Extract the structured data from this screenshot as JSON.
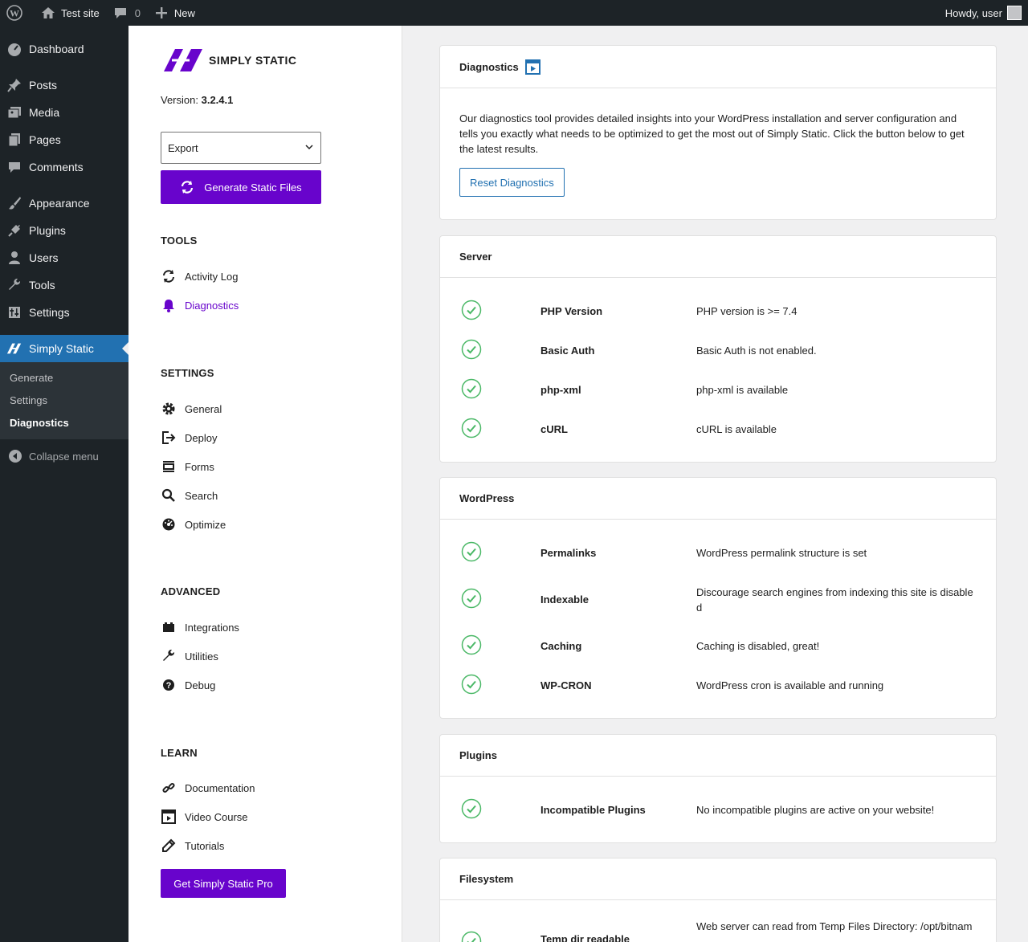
{
  "adminbar": {
    "site_name": "Test site",
    "comments_count": "0",
    "new_label": "New",
    "howdy": "Howdy, user"
  },
  "menu": {
    "items": [
      {
        "label": "Dashboard",
        "icon": "dashboard-icon"
      },
      {
        "label": "Posts",
        "icon": "pin-icon"
      },
      {
        "label": "Media",
        "icon": "media-icon"
      },
      {
        "label": "Pages",
        "icon": "pages-icon"
      },
      {
        "label": "Comments",
        "icon": "comment-icon"
      },
      {
        "label": "Appearance",
        "icon": "brush-icon"
      },
      {
        "label": "Plugins",
        "icon": "plug-icon"
      },
      {
        "label": "Users",
        "icon": "user-icon"
      },
      {
        "label": "Tools",
        "icon": "wrench-icon"
      },
      {
        "label": "Settings",
        "icon": "sliders-icon"
      },
      {
        "label": "Simply Static",
        "icon": "simply-static-icon"
      }
    ],
    "submenu": [
      "Generate",
      "Settings",
      "Diagnostics"
    ],
    "collapse": "Collapse menu"
  },
  "sidebar": {
    "logo_text": "SIMPLY STATIC",
    "version_label": "Version:",
    "version": "3.2.4.1",
    "select_value": "Export",
    "generate_button": "Generate Static Files",
    "tools_title": "TOOLS",
    "tools": [
      {
        "label": "Activity Log",
        "icon": "refresh-icon"
      },
      {
        "label": "Diagnostics",
        "icon": "bell-icon"
      }
    ],
    "settings_title": "SETTINGS",
    "settings": [
      {
        "label": "General",
        "icon": "gear-icon"
      },
      {
        "label": "Deploy",
        "icon": "exit-icon"
      },
      {
        "label": "Forms",
        "icon": "form-icon"
      },
      {
        "label": "Search",
        "icon": "search-icon"
      },
      {
        "label": "Optimize",
        "icon": "gauge-icon"
      }
    ],
    "advanced_title": "ADVANCED",
    "advanced": [
      {
        "label": "Integrations",
        "icon": "integrations-icon"
      },
      {
        "label": "Utilities",
        "icon": "wrench-icon"
      },
      {
        "label": "Debug",
        "icon": "help-icon"
      }
    ],
    "learn_title": "LEARN",
    "learn": [
      {
        "label": "Documentation",
        "icon": "link-icon"
      },
      {
        "label": "Video Course",
        "icon": "video-icon"
      },
      {
        "label": "Tutorials",
        "icon": "pencil-icon"
      }
    ],
    "pro_button": "Get Simply Static Pro"
  },
  "diagnostics": {
    "title": "Diagnostics",
    "description": "Our diagnostics tool provides detailed insights into your WordPress installation and server configuration and tells you exactly what needs to be optimized to get the most out of Simply Static. Click the button below to get the latest results.",
    "reset_button": "Reset Diagnostics"
  },
  "server": {
    "title": "Server",
    "rows": [
      {
        "label": "PHP Version",
        "value": "PHP version is >= 7.4"
      },
      {
        "label": "Basic Auth",
        "value": "Basic Auth is not enabled."
      },
      {
        "label": "php-xml",
        "value": "php-xml is available"
      },
      {
        "label": "cURL",
        "value": "cURL is available"
      }
    ]
  },
  "wordpress": {
    "title": "WordPress",
    "rows": [
      {
        "label": "Permalinks",
        "value": "WordPress permalink structure is set"
      },
      {
        "label": "Indexable",
        "value": "Discourage search engines from indexing this site is disabled"
      },
      {
        "label": "Caching",
        "value": "Caching is disabled, great!"
      },
      {
        "label": "WP-CRON",
        "value": "WordPress cron is available and running"
      }
    ]
  },
  "plugins": {
    "title": "Plugins",
    "rows": [
      {
        "label": "Incompatible Plugins",
        "value": "No incompatible plugins are active on your website!"
      }
    ]
  },
  "filesystem": {
    "title": "Filesystem",
    "rows": [
      {
        "label": "Temp dir readable",
        "value": "Web server can read from Temp Files Directory: /opt/bitnam"
      }
    ]
  },
  "colors": {
    "brand_purple": "#6804cc",
    "wp_blue": "#2271b1",
    "check_green": "#4ab866"
  }
}
